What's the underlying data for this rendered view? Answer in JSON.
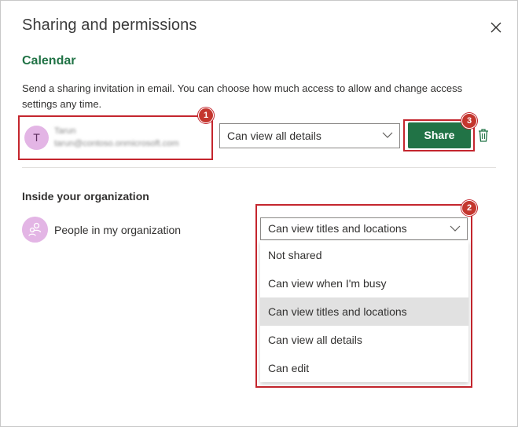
{
  "dialog": {
    "title": "Sharing and permissions",
    "close_icon": "close-icon"
  },
  "calendar": {
    "heading": "Calendar",
    "description": "Send a sharing invitation in email. You can choose how much access to allow and change access settings any time.",
    "person": {
      "initial": "T",
      "name": "Tarun",
      "email": "tarun@contoso.onmicrosoft.com"
    },
    "permission_value": "Can view all details",
    "share_label": "Share",
    "delete_icon": "trash-icon"
  },
  "organization": {
    "heading": "Inside your organization",
    "label": "People in my organization",
    "selected_value": "Can view titles and locations",
    "options": [
      "Not shared",
      "Can view when I'm busy",
      "Can view titles and locations",
      "Can view all details",
      "Can edit"
    ],
    "selected_index": 2
  },
  "callouts": [
    "1",
    "2",
    "3"
  ],
  "colors": {
    "accent_green": "#217346",
    "callout_red": "#c4262e",
    "avatar_pink": "#e3b5e5"
  }
}
